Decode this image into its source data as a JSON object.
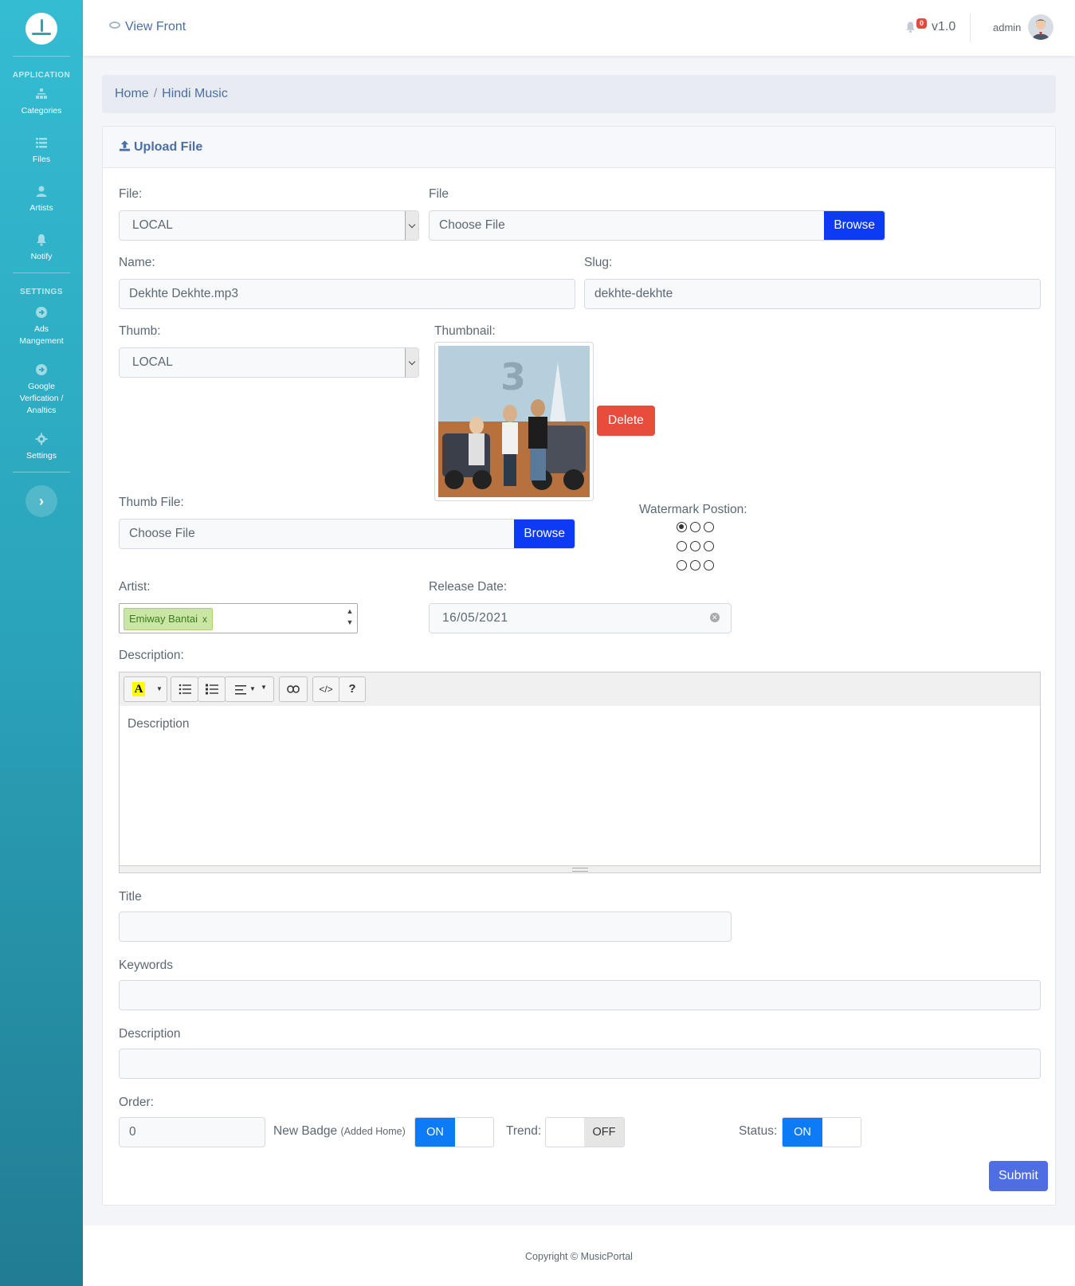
{
  "sidebar": {
    "sections": {
      "application": "APPLICATION",
      "settings": "SETTINGS"
    },
    "items": [
      {
        "label": "Categories",
        "icon": "sitemap-icon"
      },
      {
        "label": "Files",
        "icon": "list-icon"
      },
      {
        "label": "Artists",
        "icon": "user-icon"
      },
      {
        "label": "Notify",
        "icon": "bell-icon"
      },
      {
        "label": "Ads Mangement",
        "icon": "arrow-circle-icon"
      },
      {
        "label": "Google Verfication / Analtics",
        "icon": "arrow-circle-icon"
      },
      {
        "label": "Settings",
        "icon": "gear-icon"
      }
    ],
    "toggle": "›"
  },
  "header": {
    "view_front": "View Front",
    "notification_count": "0",
    "version": "v1.0",
    "user": "admin"
  },
  "breadcrumb": {
    "home": "Home",
    "current": "Hindi Music"
  },
  "card": {
    "title": "Upload File"
  },
  "form": {
    "file_source_label": "File:",
    "file_source_value": "LOCAL",
    "file_label": "File",
    "file_placeholder": "Choose File",
    "browse_label": "Browse",
    "name_label": "Name:",
    "name_value": "Dekhte Dekhte.mp3",
    "slug_label": "Slug:",
    "slug_value": "dekhte-dekhte",
    "thumb_label": "Thumb:",
    "thumb_value": "LOCAL",
    "thumbnail_label": "Thumbnail:",
    "delete_label": "Delete",
    "thumb_file_label": "Thumb File:",
    "thumb_file_placeholder": "Choose File",
    "thumb_browse_label": "Browse",
    "watermark_label": "Watermark Postion:",
    "watermark_selected": "top-left",
    "artist_label": "Artist:",
    "artist_tag": "Emiway Bantai",
    "artist_tag_remove": "x",
    "release_label": "Release Date:",
    "release_value": "16/05/2021",
    "description_label": "Description:",
    "editor_placeholder": "Description",
    "seo_title_label": "Title",
    "seo_keywords_label": "Keywords",
    "seo_description_label": "Description",
    "order_label": "Order:",
    "order_value": "0",
    "new_badge_label": "New Badge",
    "new_badge_hint": "(Added Home)",
    "new_badge_state": "ON",
    "trend_label": "Trend:",
    "trend_state": "OFF",
    "status_label": "Status:",
    "status_state": "ON",
    "submit_label": "Submit"
  },
  "footer": {
    "copyright": "Copyright © MusicPortal"
  },
  "colors": {
    "primary_blue": "#0d3af5",
    "toggle_blue": "#0d7bf5",
    "delete_red": "#e74c3c",
    "submit_blue": "#4f6ee1",
    "sidebar_teal": "#2aa3b9"
  }
}
